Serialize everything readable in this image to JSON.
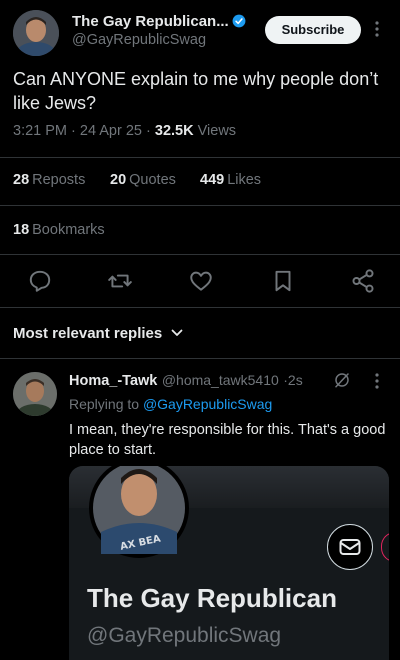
{
  "post": {
    "author_name": "The Gay Republican...",
    "author_handle": "@GayRepublicSwag",
    "subscribe_label": "Subscribe",
    "text": "Can ANYONE explain to me why people don’t like Jews?",
    "time": "3:21 PM",
    "date": "24 Apr 25",
    "views_count": "32.5K",
    "views_label": "Views",
    "meta_separator": "·"
  },
  "stats": {
    "reposts_count": "28",
    "reposts_label": "Reposts",
    "quotes_count": "20",
    "quotes_label": "Quotes",
    "likes_count": "449",
    "likes_label": "Likes",
    "bookmarks_count": "18",
    "bookmarks_label": "Bookmarks"
  },
  "actions": [
    "reply-icon",
    "repost-icon",
    "like-icon",
    "bookmark-icon",
    "share-icon"
  ],
  "replies_section": {
    "title": "Most relevant replies"
  },
  "reply": {
    "author_name": "Homa_-Tawk",
    "author_handle": "@homa_tawk5410",
    "time_sep": "·",
    "time": "2s",
    "replying_prefix": "Replying to",
    "replying_to": "@GayRepublicSwag",
    "text": "I mean, they're responsible for this. That's a good place to start."
  },
  "media": {
    "display_name": "The Gay Republican",
    "handle": "@GayRepublicSwag",
    "shirt_text": "AX BEA"
  },
  "colors": {
    "background": "#000000",
    "text_primary": "#e7e9ea",
    "text_secondary": "#71767b",
    "accent_link": "#1d9bf0",
    "verified_badge": "#1d9bf0",
    "divider": "#2f3336"
  }
}
